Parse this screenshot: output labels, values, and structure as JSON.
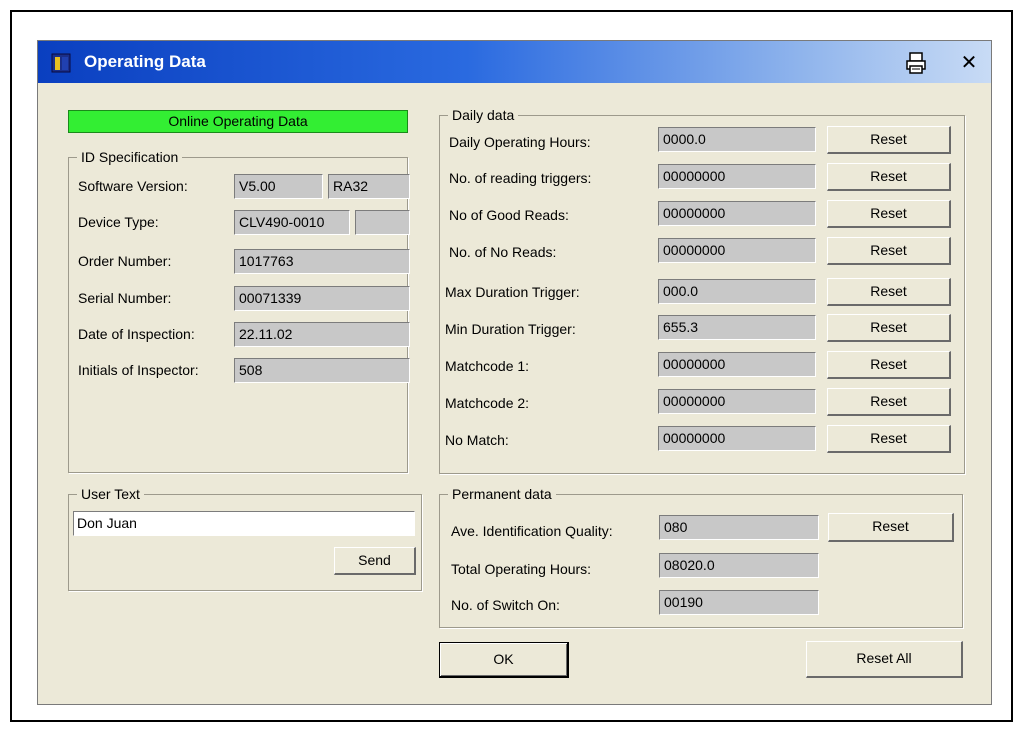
{
  "window": {
    "title": "Operating Data"
  },
  "status": {
    "label": "Online Operating Data",
    "color": "#33ee33"
  },
  "id_spec": {
    "legend": "ID Specification",
    "software_version_label": "Software Version:",
    "software_version": "V5.00",
    "software_version_extra": "RA32",
    "device_type_label": "Device Type:",
    "device_type": "CLV490-0010",
    "device_type_extra": "",
    "order_number_label": "Order Number:",
    "order_number": "1017763",
    "serial_number_label": "Serial Number:",
    "serial_number": "00071339",
    "date_of_inspection_label": "Date of Inspection:",
    "date_of_inspection": "22.11.02",
    "initials_label": "Initials of Inspector:",
    "initials": "508"
  },
  "user_text": {
    "legend": "User Text",
    "value": "Don Juan",
    "send_label": "Send"
  },
  "daily": {
    "legend": "Daily data",
    "reset_label": "Reset",
    "rows": [
      {
        "label": "Daily Operating Hours:",
        "value": "0000.0"
      },
      {
        "label": "No. of reading triggers:",
        "value": "00000000"
      },
      {
        "label": "No of Good Reads:",
        "value": "00000000"
      },
      {
        "label": "No. of No Reads:",
        "value": "00000000"
      },
      {
        "label": "Max Duration Trigger:",
        "value": "000.0"
      },
      {
        "label": "Min Duration Trigger:",
        "value": "655.3"
      },
      {
        "label": "Matchcode 1:",
        "value": "00000000"
      },
      {
        "label": "Matchcode 2:",
        "value": "00000000"
      },
      {
        "label": "No Match:",
        "value": "00000000"
      }
    ]
  },
  "permanent": {
    "legend": "Permanent data",
    "reset_label": "Reset",
    "rows": [
      {
        "label": "Ave. Identification Quality:",
        "value": "080"
      },
      {
        "label": "Total Operating Hours:",
        "value": "08020.0"
      },
      {
        "label": "No. of Switch On:",
        "value": "00190"
      }
    ]
  },
  "footer": {
    "ok_label": "OK",
    "reset_all_label": "Reset All"
  },
  "icons": {
    "app": "book-icon",
    "print": "printer-icon",
    "close": "close-icon"
  }
}
